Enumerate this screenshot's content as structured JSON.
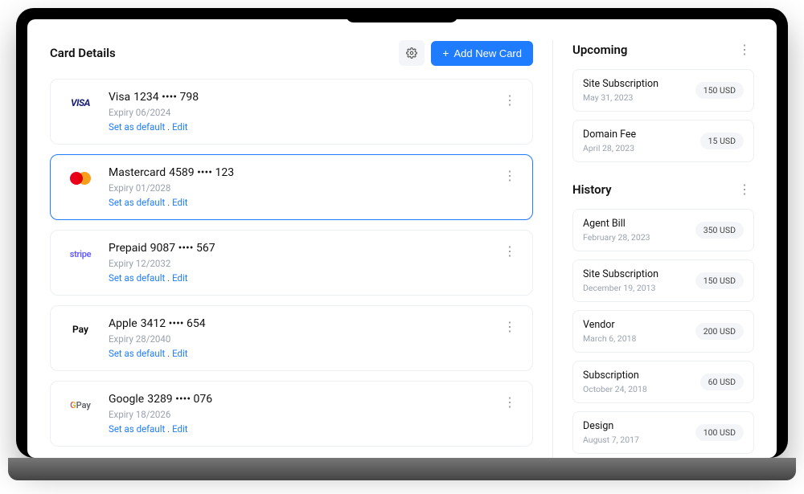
{
  "header": {
    "title": "Card Details",
    "add_button": "Add New Card"
  },
  "actions": {
    "set_default": "Set as default",
    "sep": " . ",
    "edit": "Edit"
  },
  "cards": [
    {
      "logo": "visa",
      "brand": "Visa",
      "number": "1234 •••• 798",
      "expiry": "Expiry 06/2024",
      "selected": false
    },
    {
      "logo": "mastercard",
      "brand": "Mastercard",
      "number": "4589 •••• 123",
      "expiry": "Expiry 01/2028",
      "selected": true
    },
    {
      "logo": "stripe",
      "brand": "Prepaid",
      "number": "9087 •••• 567",
      "expiry": "Expiry 12/2032",
      "selected": false
    },
    {
      "logo": "applepay",
      "brand": "Apple",
      "number": "3412 •••• 654",
      "expiry": "Expiry 28/2040",
      "selected": false
    },
    {
      "logo": "googlepay",
      "brand": "Google",
      "number": "3289 •••• 076",
      "expiry": "Expiry 18/2026",
      "selected": false
    }
  ],
  "upcoming": {
    "title": "Upcoming",
    "items": [
      {
        "title": "Site Subscription",
        "date": "May 31, 2023",
        "amount": "150 USD"
      },
      {
        "title": "Domain Fee",
        "date": "April 28, 2023",
        "amount": "15 USD"
      }
    ]
  },
  "history": {
    "title": "History",
    "items": [
      {
        "title": "Agent Bill",
        "date": "February 28, 2023",
        "amount": "350 USD"
      },
      {
        "title": "Site Subscription",
        "date": "December 19, 2013",
        "amount": "150 USD"
      },
      {
        "title": "Vendor",
        "date": "March 6, 2018",
        "amount": "200 USD"
      },
      {
        "title": "Subscription",
        "date": "October 24, 2018",
        "amount": "60 USD"
      },
      {
        "title": "Design",
        "date": "August 7, 2017",
        "amount": "100 USD"
      }
    ]
  }
}
